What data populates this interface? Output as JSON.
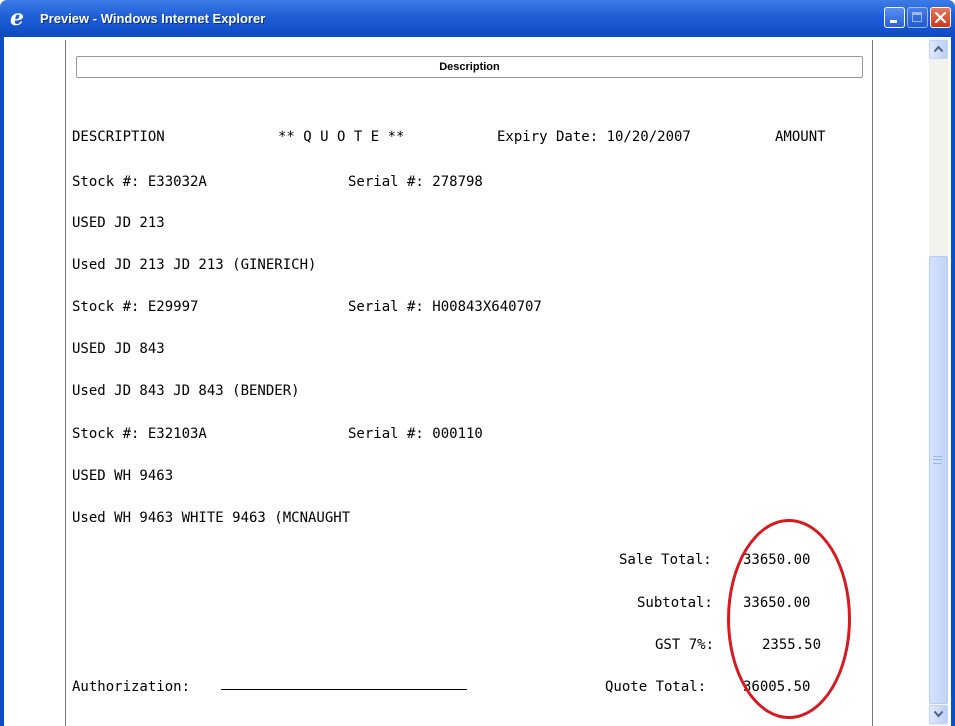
{
  "window": {
    "title": "Preview - Windows Internet Explorer",
    "icon": "internet-explorer-icon",
    "titlebar_color": "#1f5fd6",
    "buttons": [
      "minimize-icon",
      "maximize-icon",
      "close-icon"
    ]
  },
  "document": {
    "section_header": "Description",
    "header_row": {
      "description_label": "DESCRIPTION",
      "quote_label": "** Q U O T E **",
      "expiry_label": "Expiry Date: 10/20/2007",
      "amount_label": "AMOUNT"
    },
    "items": [
      {
        "stock": "Stock #: E33032A",
        "serial": "Serial #: 278798",
        "model": "USED JD 213",
        "detail": "Used JD 213 JD 213 (GINERICH)"
      },
      {
        "stock": "Stock #: E29997",
        "serial": "Serial #: H00843X640707",
        "model": "USED JD 843",
        "detail": "Used JD 843 JD 843 (BENDER)"
      },
      {
        "stock": "Stock #: E32103A",
        "serial": "Serial #: 000110",
        "model": "USED WH 9463",
        "detail": "Used WH 9463 WHITE 9463 (MCNAUGHT"
      }
    ],
    "totals": {
      "sale_total_label": "Sale Total:",
      "sale_total_value": "33650.00",
      "subtotal_label": "Subtotal:",
      "subtotal_value": "33650.00",
      "gst_label": "GST 7%:",
      "gst_value": "2355.50",
      "quote_total_label": "Quote Total:",
      "quote_total_value": "36005.50"
    },
    "authorization_label": "Authorization:",
    "highlight_color": "#d71920"
  }
}
